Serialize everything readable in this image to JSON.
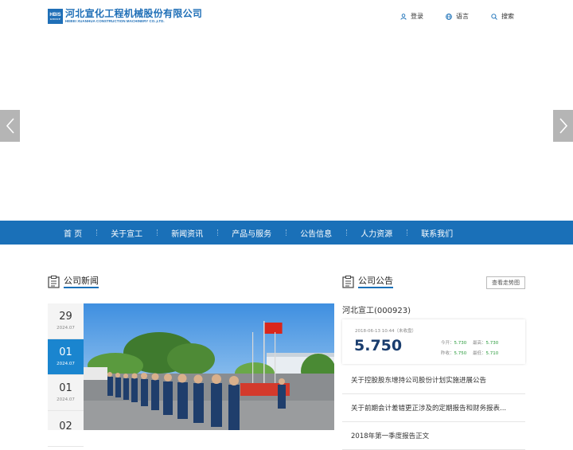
{
  "header": {
    "logo_badge": "HBIS",
    "logo_badge_sub": "GROUP",
    "logo_cn": "河北宣化工程机械股份有限公司",
    "logo_en": "HEBEI XUANHUA CONSTRUCTION MACHINERY CO.,LTD.",
    "links": [
      {
        "label": "登录",
        "icon": "user-icon"
      },
      {
        "label": "语言",
        "icon": "globe-icon"
      },
      {
        "label": "搜索",
        "icon": "search-icon"
      }
    ]
  },
  "nav": {
    "items": [
      "首 页",
      "关于宣工",
      "新闻资讯",
      "产品与服务",
      "公告信息",
      "人力资源",
      "联系我们"
    ]
  },
  "news": {
    "title": "公司新闻",
    "dates": [
      {
        "day": "29",
        "ym": "2024.07",
        "active": false
      },
      {
        "day": "01",
        "ym": "2024.07",
        "active": true
      },
      {
        "day": "01",
        "ym": "2024.07",
        "active": false
      },
      {
        "day": "02",
        "ym": "",
        "active": false
      }
    ]
  },
  "notice": {
    "title": "公司公告",
    "view_button": "查看走势图",
    "stock_name": "河北宣工(000923)",
    "stock_time": "2018-06-13 10:44（未收盘）",
    "stock_price": "5.750",
    "stock_stats": [
      {
        "label": "今开：",
        "value": "5.730"
      },
      {
        "label": "最高：",
        "value": "5.730"
      },
      {
        "label": "昨收：",
        "value": "5.750"
      },
      {
        "label": "最低：",
        "value": "5.710"
      }
    ],
    "items": [
      "关于控股股东增持公司股份计划实施进展公告",
      "关于前期会计差错更正涉及的定期报告和财务报表...",
      "2018年第一季度报告正文"
    ]
  },
  "colors": {
    "brand": "#1a70b8",
    "date_active": "#1a85cf",
    "stock_up": "#2a9b3c"
  }
}
